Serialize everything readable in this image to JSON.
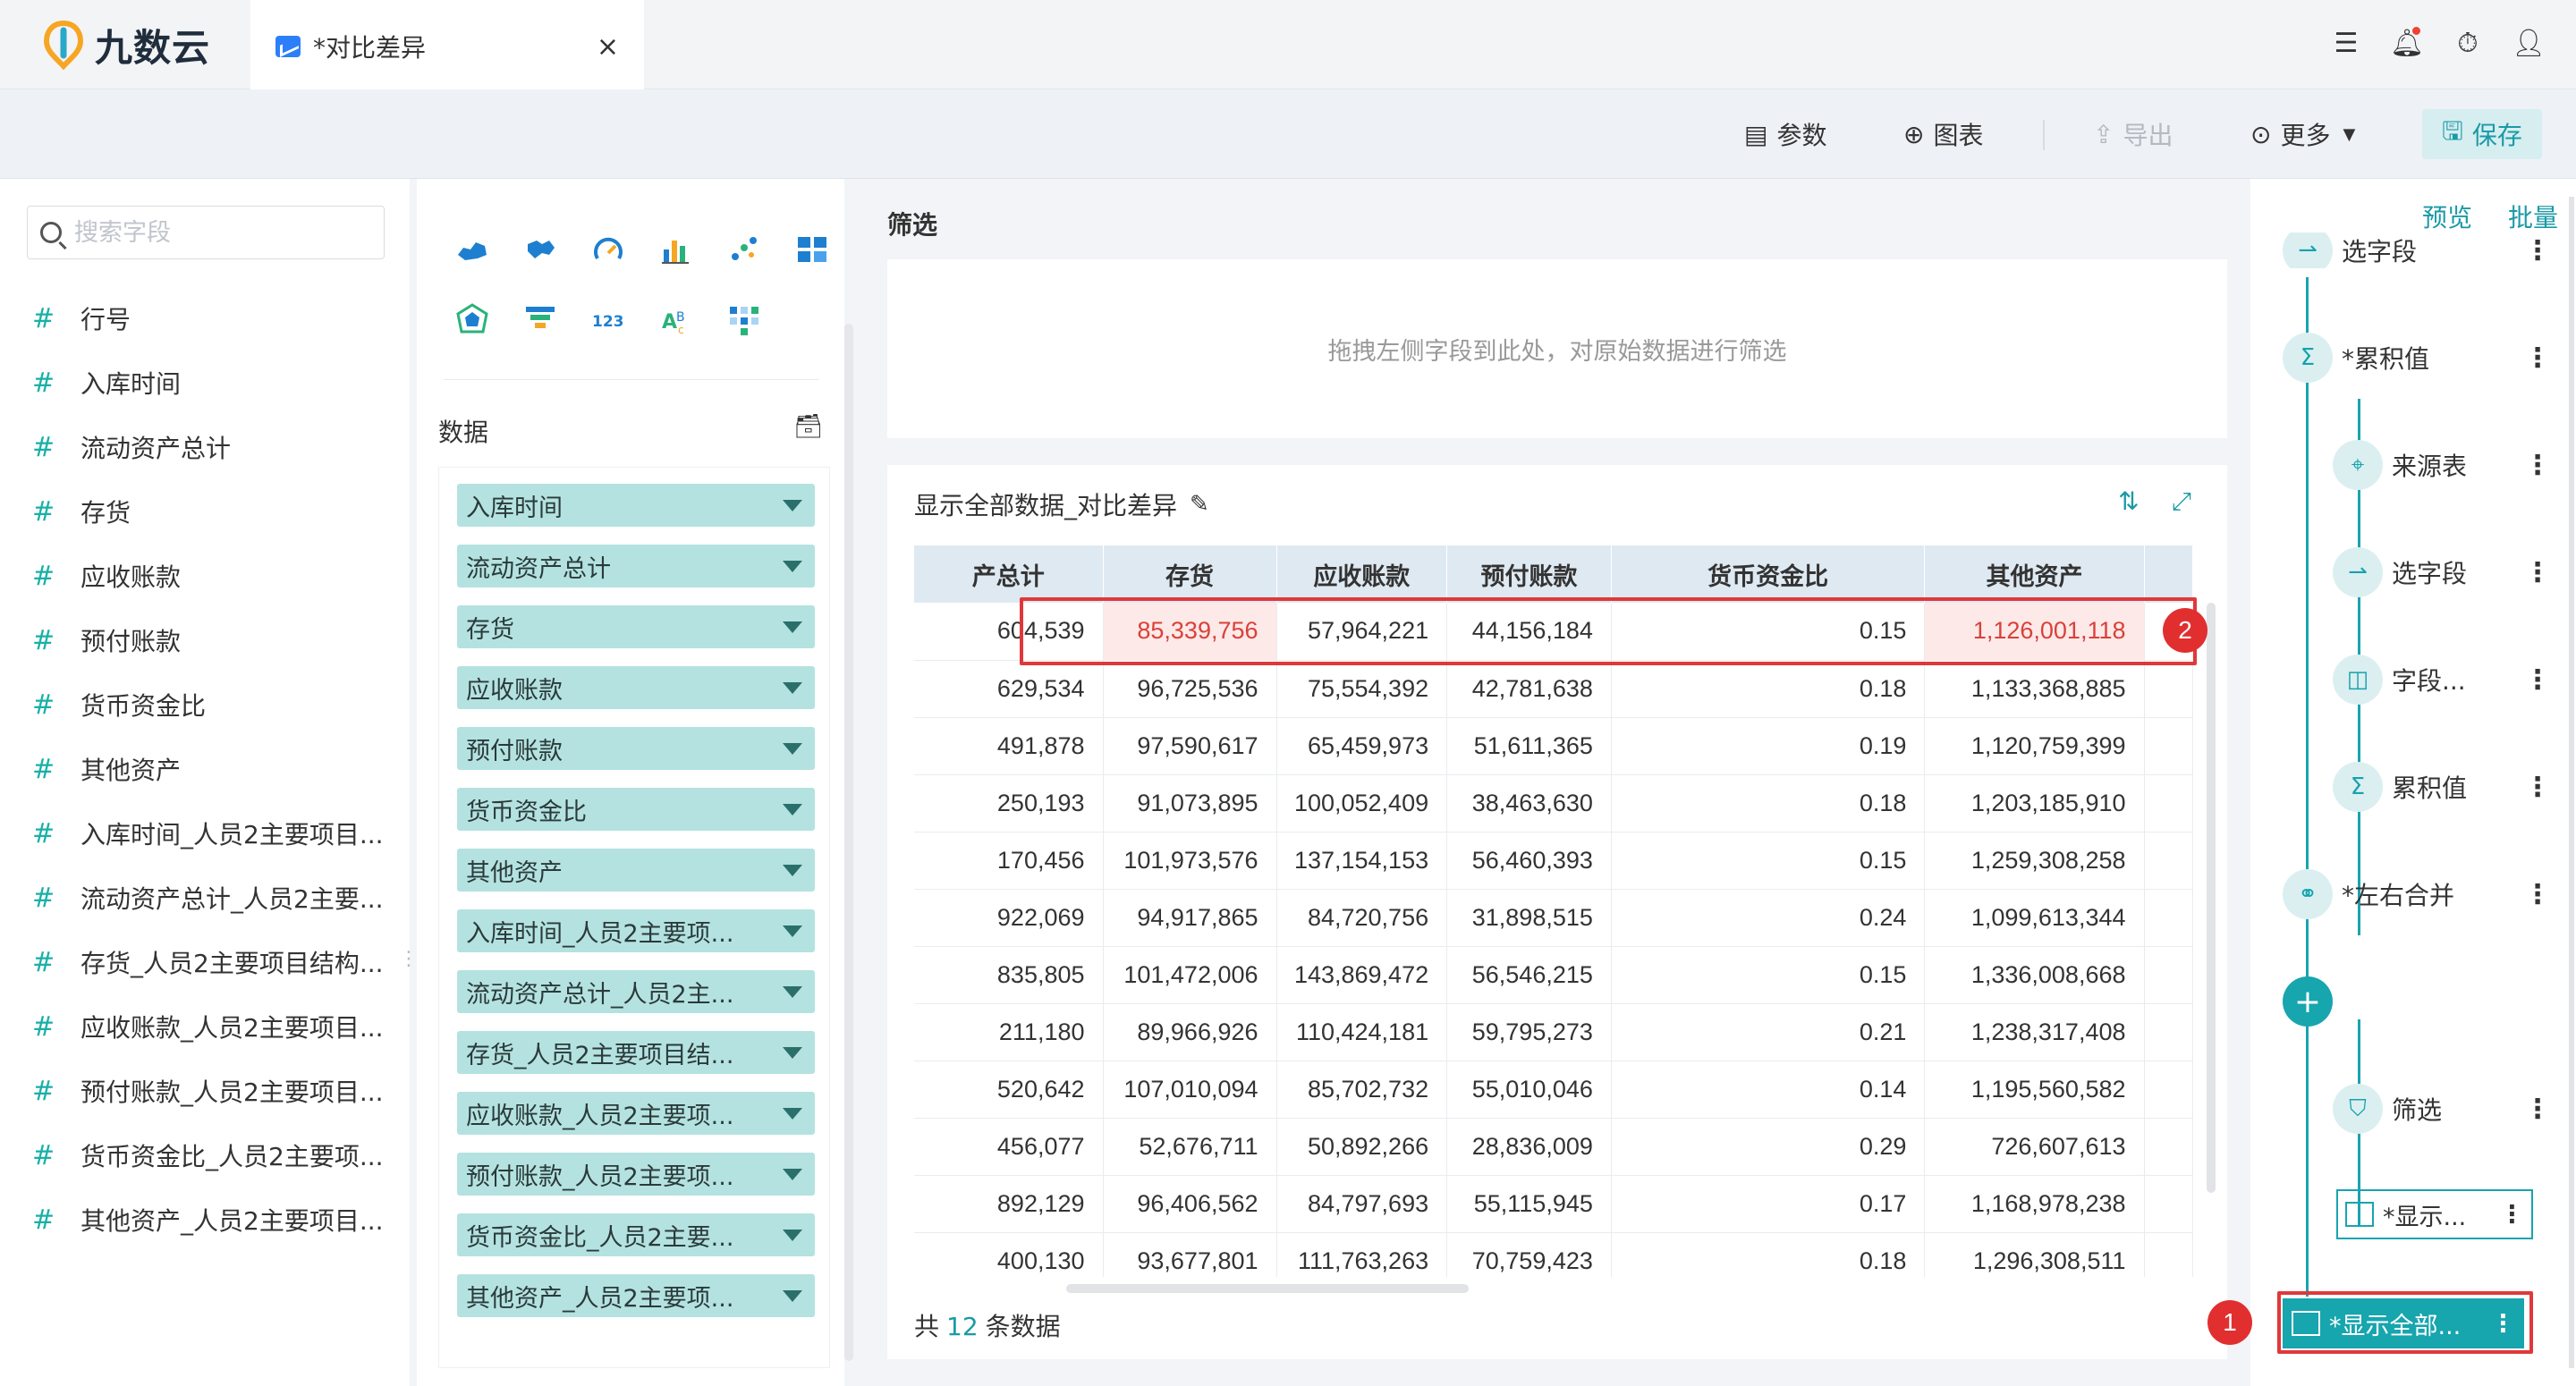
{
  "app": {
    "logo_text": "九数云"
  },
  "tab": {
    "label": "*对比差异",
    "close": "×"
  },
  "toolbar": {
    "params": "参数",
    "chart": "图表",
    "export": "导出",
    "more": "更多",
    "save": "保存"
  },
  "field_panel": {
    "search_placeholder": "搜索字段",
    "fields": [
      "行号",
      "入库时间",
      "流动资产总计",
      "存货",
      "应收账款",
      "预付账款",
      "货币资金比",
      "其他资产",
      "入库时间_人员2主要项目...",
      "流动资产总计_人员2主要...",
      "存货_人员2主要项目结构...",
      "应收账款_人员2主要项目...",
      "预付账款_人员2主要项目...",
      "货币资金比_人员2主要项...",
      "其他资产_人员2主要项目..."
    ]
  },
  "chart_panel": {
    "data_title": "数据",
    "chips": [
      "入库时间",
      "流动资产总计",
      "存货",
      "应收账款",
      "预付账款",
      "货币资金比",
      "其他资产",
      "入库时间_人员2主要项...",
      "流动资产总计_人员2主...",
      "存货_人员2主要项目结...",
      "应收账款_人员2主要项...",
      "预付账款_人员2主要项...",
      "货币资金比_人员2主要...",
      "其他资产_人员2主要项..."
    ]
  },
  "filter": {
    "title": "筛选",
    "hint": "拖拽左侧字段到此处，对原始数据进行筛选"
  },
  "table": {
    "title": "显示全部数据_对比差异",
    "headers": [
      "产总计",
      "存货",
      "应收账款",
      "预付账款",
      "货币资金比",
      "其他资产"
    ],
    "rows": [
      [
        "604,539",
        "85,339,756",
        "57,964,221",
        "44,156,184",
        "0.15",
        "1,126,001,118"
      ],
      [
        "629,534",
        "96,725,536",
        "75,554,392",
        "42,781,638",
        "0.18",
        "1,133,368,885"
      ],
      [
        "491,878",
        "97,590,617",
        "65,459,973",
        "51,611,365",
        "0.19",
        "1,120,759,399"
      ],
      [
        "250,193",
        "91,073,895",
        "100,052,409",
        "38,463,630",
        "0.18",
        "1,203,185,910"
      ],
      [
        "170,456",
        "101,973,576",
        "137,154,153",
        "56,460,393",
        "0.15",
        "1,259,308,258"
      ],
      [
        "922,069",
        "94,917,865",
        "84,720,756",
        "31,898,515",
        "0.24",
        "1,099,613,344"
      ],
      [
        "835,805",
        "101,472,006",
        "143,869,472",
        "56,546,215",
        "0.15",
        "1,336,008,668"
      ],
      [
        "211,180",
        "89,966,926",
        "110,424,181",
        "59,795,273",
        "0.21",
        "1,238,317,408"
      ],
      [
        "520,642",
        "107,010,094",
        "85,702,732",
        "55,010,046",
        "0.14",
        "1,195,560,582"
      ],
      [
        "456,077",
        "52,676,711",
        "50,892,266",
        "28,836,009",
        "0.29",
        "726,607,613"
      ],
      [
        "892,129",
        "96,406,562",
        "84,797,693",
        "55,115,945",
        "0.17",
        "1,168,978,238"
      ],
      [
        "400,130",
        "93,677,801",
        "111,763,263",
        "70,759,423",
        "0.18",
        "1,296,308,511"
      ]
    ],
    "footer_prefix": "共",
    "footer_count": "12",
    "footer_suffix": "条数据"
  },
  "badges": {
    "one": "1",
    "two": "2"
  },
  "flow": {
    "preview": "预览",
    "batch": "批量",
    "nodes": {
      "select_field_top": "选字段",
      "cumulative_main": "*累积值",
      "source_table": "来源表",
      "select_field": "选字段",
      "field_more": "字段...",
      "cumulative": "累积值",
      "left_right_merge": "*左右合并",
      "filter": "筛选",
      "display_short": "*显示...",
      "display_all": "*显示全部..."
    }
  },
  "colors": {
    "accent": "#17a5ae",
    "chip": "#b4e2e0",
    "highlight_bg": "#fde9e7",
    "highlight_text": "#d9413a",
    "annotation_red": "#e0383a"
  }
}
